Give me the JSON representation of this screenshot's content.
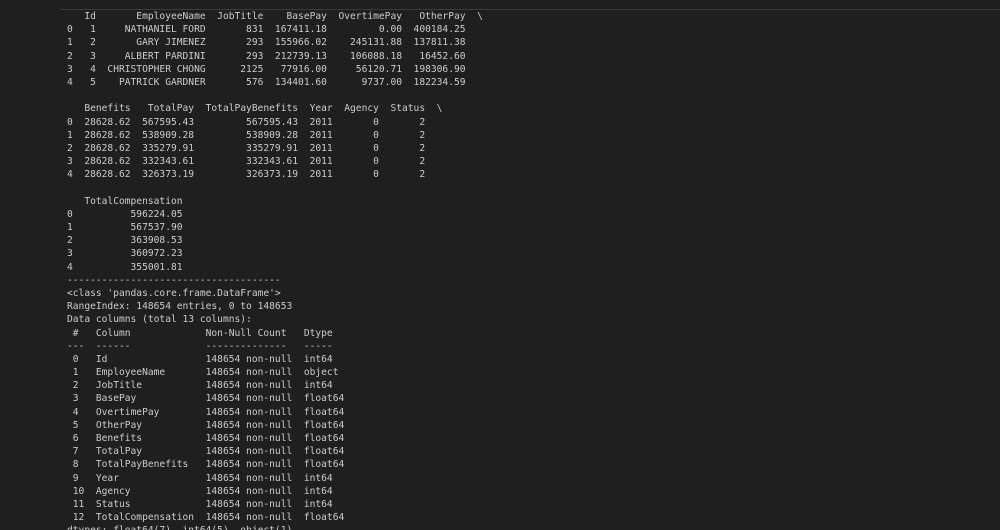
{
  "output": {
    "lines": [
      "   Id       EmployeeName  JobTitle    BasePay  OvertimePay   OtherPay  \\",
      "0   1     NATHANIEL FORD       831  167411.18         0.00  400184.25",
      "1   2       GARY JIMENEZ       293  155966.02    245131.88  137811.38",
      "2   3     ALBERT PARDINI       293  212739.13    106088.18   16452.60",
      "3   4  CHRISTOPHER CHONG      2125   77916.00     56120.71  198306.90",
      "4   5    PATRICK GARDNER       576  134401.60      9737.00  182234.59",
      "",
      "   Benefits   TotalPay  TotalPayBenefits  Year  Agency  Status  \\",
      "0  28628.62  567595.43         567595.43  2011       0       2",
      "1  28628.62  538909.28         538909.28  2011       0       2",
      "2  28628.62  335279.91         335279.91  2011       0       2",
      "3  28628.62  332343.61         332343.61  2011       0       2",
      "4  28628.62  326373.19         326373.19  2011       0       2",
      "",
      "   TotalCompensation",
      "0          596224.05",
      "1          567537.90",
      "2          363908.53",
      "3          360972.23",
      "4          355001.81",
      "-------------------------------------",
      "<class 'pandas.core.frame.DataFrame'>",
      "RangeIndex: 148654 entries, 0 to 148653",
      "Data columns (total 13 columns):",
      " #   Column             Non-Null Count   Dtype",
      "---  ------             --------------   -----",
      " 0   Id                 148654 non-null  int64",
      " 1   EmployeeName       148654 non-null  object",
      " 2   JobTitle           148654 non-null  int64",
      " 3   BasePay            148654 non-null  float64",
      " 4   OvertimePay        148654 non-null  float64",
      " 5   OtherPay           148654 non-null  float64",
      " 6   Benefits           148654 non-null  float64",
      " 7   TotalPay           148654 non-null  float64",
      " 8   TotalPayBenefits   148654 non-null  float64",
      " 9   Year               148654 non-null  int64",
      " 10  Agency             148654 non-null  int64",
      " 11  Status             148654 non-null  int64",
      " 12  TotalCompensation  148654 non-null  float64",
      "dtypes: float64(7), int64(5), object(1)"
    ]
  }
}
